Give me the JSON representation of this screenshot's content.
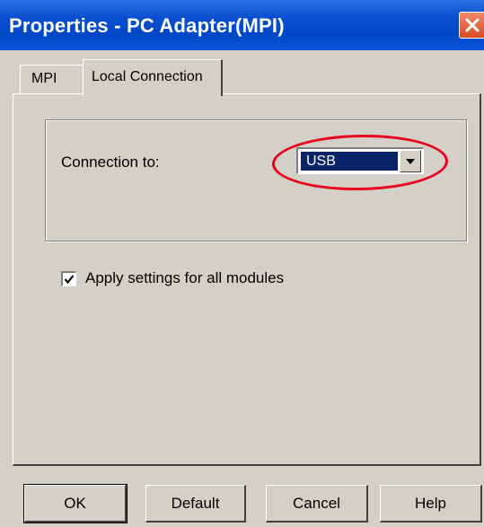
{
  "window": {
    "title": "Properties - PC Adapter(MPI)",
    "close_icon": "close-icon"
  },
  "tabs": [
    {
      "label": "MPI",
      "active": false
    },
    {
      "label": "Local Connection",
      "active": true
    }
  ],
  "local_connection": {
    "connection_label": "Connection to:",
    "connection_value": "USB",
    "dropdown_icon": "chevron-down-icon",
    "highlight_color": "#e8001c",
    "apply_label": "Apply settings for all modules",
    "apply_checked": true
  },
  "buttons": {
    "ok": "OK",
    "default": "Default",
    "cancel": "Cancel",
    "help": "Help"
  },
  "colors": {
    "titlebar": "#0047c8",
    "close": "#d94a22",
    "selection": "#0a246a",
    "face": "#d4d0c8"
  }
}
